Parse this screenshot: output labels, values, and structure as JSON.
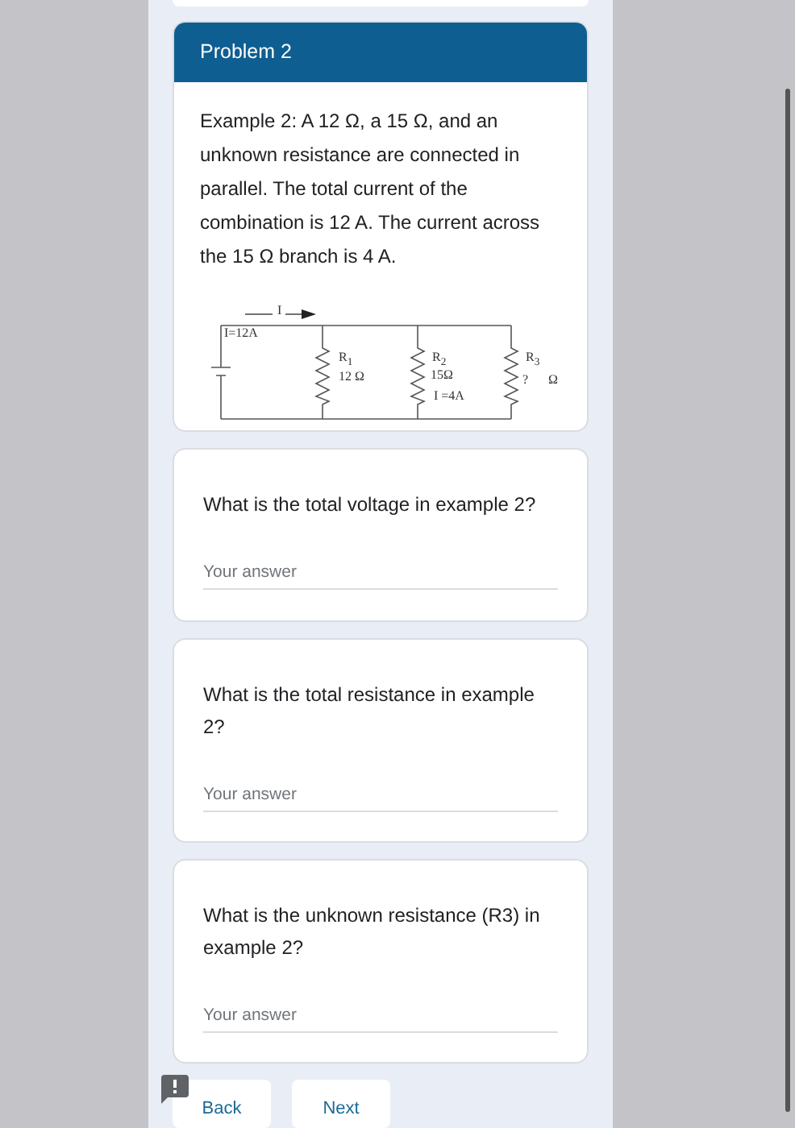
{
  "problem": {
    "title": "Problem 2",
    "text": "Example 2: A 12 Ω, a 15 Ω, and an unknown resistance are connected in parallel. The total current of the combination is 12 A. The current across the 15 Ω branch is 4 A.",
    "diagram_labels": [
      "I",
      "I=12A",
      "R$_{1}$",
      "12 Ω",
      "R$_{2}$",
      "15Ω",
      "I =4A",
      "R$_{3}$",
      "?",
      "Ω"
    ]
  },
  "questions": [
    {
      "text": "What is the total voltage in example 2?",
      "placeholder": "Your answer"
    },
    {
      "text": "What is the total resistance in example 2?",
      "placeholder": "Your answer"
    },
    {
      "text": "What is the unknown resistance (R3) in example 2?",
      "placeholder": "Your answer"
    }
  ],
  "buttons": [
    "Back",
    "Next"
  ]
}
